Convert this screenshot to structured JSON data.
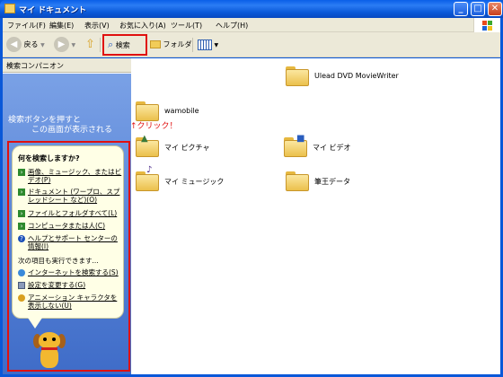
{
  "window": {
    "title": "マイ ドキュメント",
    "controls": {
      "minimize": "_",
      "maximize": "□",
      "close": "✕"
    }
  },
  "menu": [
    "ファイル(F)",
    "編集(E)",
    "表示(V)",
    "お気に入り(A)",
    "ツール(T)",
    "ヘルプ(H)"
  ],
  "toolbar": {
    "back_label": "戻る",
    "forward_label": "",
    "search_label": "検索",
    "folders_label": "フォルダ"
  },
  "annotation": "↑クリック！",
  "search_pane": {
    "header": "検索コンパニオン",
    "hint_line1": "検索ボタンを押すと",
    "hint_line2": "この画面が表示される",
    "balloon_title": "何を検索しますか?",
    "options": [
      "画像、ミュージック、またはビデオ(P)",
      "ドキュメント (ワープロ、スプレッドシート など)(O)",
      "ファイルとフォルダすべて(L)",
      "コンピュータまたは人(C)",
      "ヘルプとサポート センターの情報(I)"
    ],
    "also_label": "次の項目も実行できます...",
    "extra_options": [
      "インターネットを検索する(S)",
      "設定を変更する(G)",
      "アニメーション キャラクタを表示しない(U)"
    ]
  },
  "files": [
    {
      "name": "Ulead DVD MovieWriter",
      "icon": "folder-icon"
    },
    {
      "name": "wamobile",
      "icon": "folder-icon"
    },
    {
      "name": "マイ ピクチャ",
      "icon": "pictures-folder-icon"
    },
    {
      "name": "マイ ビデオ",
      "icon": "video-folder-icon"
    },
    {
      "name": "マイ ミュージック",
      "icon": "music-folder-icon"
    },
    {
      "name": "筆王データ",
      "icon": "folder-icon"
    }
  ],
  "colors": {
    "titlebar": "#0A58D8",
    "highlight": "#E01010",
    "pane": "#5480D4"
  }
}
